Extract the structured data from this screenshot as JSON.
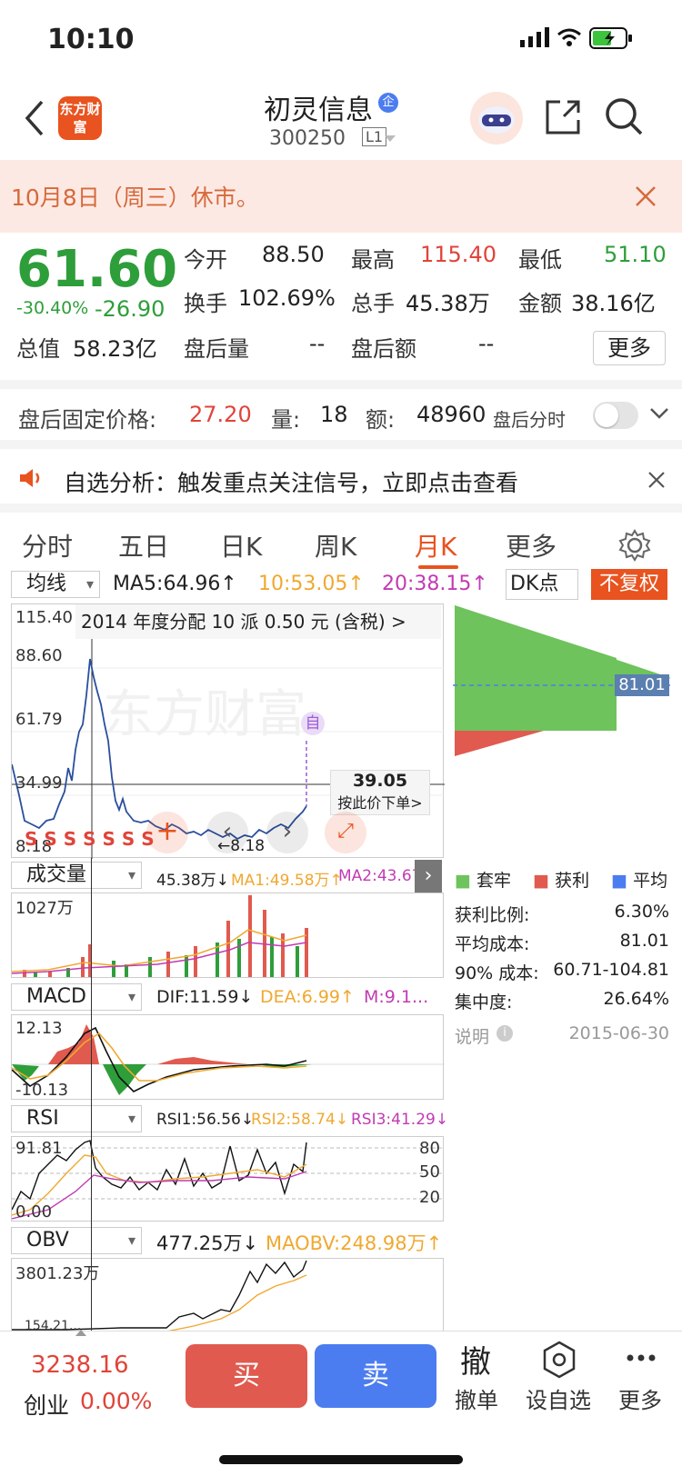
{
  "status_bar": {
    "time": "10:10"
  },
  "header": {
    "logo_text": "东方财富",
    "title": "初灵信息",
    "badge": "企",
    "code": "300250",
    "level": "L1"
  },
  "notice": {
    "text": "10月8日（周三）休市。"
  },
  "quote": {
    "price": "61.60",
    "change_pct": "-30.40%",
    "change": "-26.90",
    "open_label": "今开",
    "open": "88.50",
    "high_label": "最高",
    "high": "115.40",
    "low_label": "最低",
    "low": "51.10",
    "turnover_label": "换手",
    "turnover": "102.69%",
    "volume_label": "总手",
    "volume": "45.38万",
    "amount_label": "金额",
    "amount": "38.16亿",
    "mktcap_label": "总值",
    "mktcap": "58.23亿",
    "ah_vol_label": "盘后量",
    "ah_vol": "--",
    "ah_amt_label": "盘后额",
    "ah_amt": "--",
    "more": "更多"
  },
  "after_hours": {
    "label": "盘后固定价格:",
    "price": "27.20",
    "vol_label": "量:",
    "vol": "18",
    "amt_label": "额:",
    "amt": "48960",
    "timeshare": "盘后分时"
  },
  "alert": {
    "text": "自选分析：触发重点关注信号，立即点击查看"
  },
  "tabs": [
    "分时",
    "五日",
    "日K",
    "周K",
    "月K",
    "更多"
  ],
  "kline": {
    "indicator": "均线",
    "ma5": "MA5:64.96↑",
    "ma10": "10:53.05↑",
    "ma20": "20:38.15↑",
    "dk": "DK点",
    "adjust": "不复权",
    "dividend": "2014 年度分配 10 派 0.50 元 (含税) >",
    "y_labels": [
      "115.40",
      "88.60",
      "61.79",
      "34.99",
      "8.18"
    ],
    "low_marker": "←8.18",
    "self_marker": "自",
    "watermark": "东方财富",
    "order_price": "39.05",
    "order_hint": "按此价下单>",
    "s_marks": "S S S S S S S",
    "chip_avg": "81.01"
  },
  "volume": {
    "indicator": "成交量",
    "vol": "45.38万↓",
    "ma1": "MA1:49.58万↑",
    "ma2": "MA2:43.67...",
    "max": "1027万"
  },
  "chip_legend": {
    "trapped": "套牢",
    "profit": "获利",
    "avg": "平均"
  },
  "chip_stats": [
    {
      "label": "获利比例:",
      "value": "6.30%"
    },
    {
      "label": "平均成本:",
      "value": "81.01"
    },
    {
      "label": "90% 成本:",
      "value": "60.71-104.81"
    },
    {
      "label": "集中度:",
      "value": "26.64%"
    }
  ],
  "chip_note": {
    "label": "说明",
    "date": "2015-06-30"
  },
  "macd": {
    "indicator": "MACD",
    "dif": "DIF:11.59↓",
    "dea": "DEA:6.99↑",
    "m": "M:9.1...",
    "top": "12.13",
    "bottom": "-10.13"
  },
  "rsi": {
    "indicator": "RSI",
    "rsi1": "RSI1:56.56↓",
    "rsi2": "RSI2:58.74↓",
    "rsi3": "RSI3:41.29↓",
    "top": "91.81",
    "bottom": "0.00",
    "levels": [
      "80",
      "50",
      "20"
    ]
  },
  "obv": {
    "indicator": "OBV",
    "obv": "477.25万↓",
    "maobv": "MAOBV:248.98万↑",
    "top": "3801.23万",
    "bottom": "154.21..."
  },
  "bottom_bar": {
    "index_value": "3238.16",
    "index_name": "创业",
    "index_change": "0.00%",
    "buy": "买",
    "sell": "卖",
    "cancel": "撤单",
    "cancel_icon": "撤",
    "set_watch": "设自选",
    "more": "更多"
  },
  "colors": {
    "up": "#e0443a",
    "down": "#2e9e3a",
    "accent": "#e8531f",
    "sell_blue": "#4b7cf0"
  }
}
